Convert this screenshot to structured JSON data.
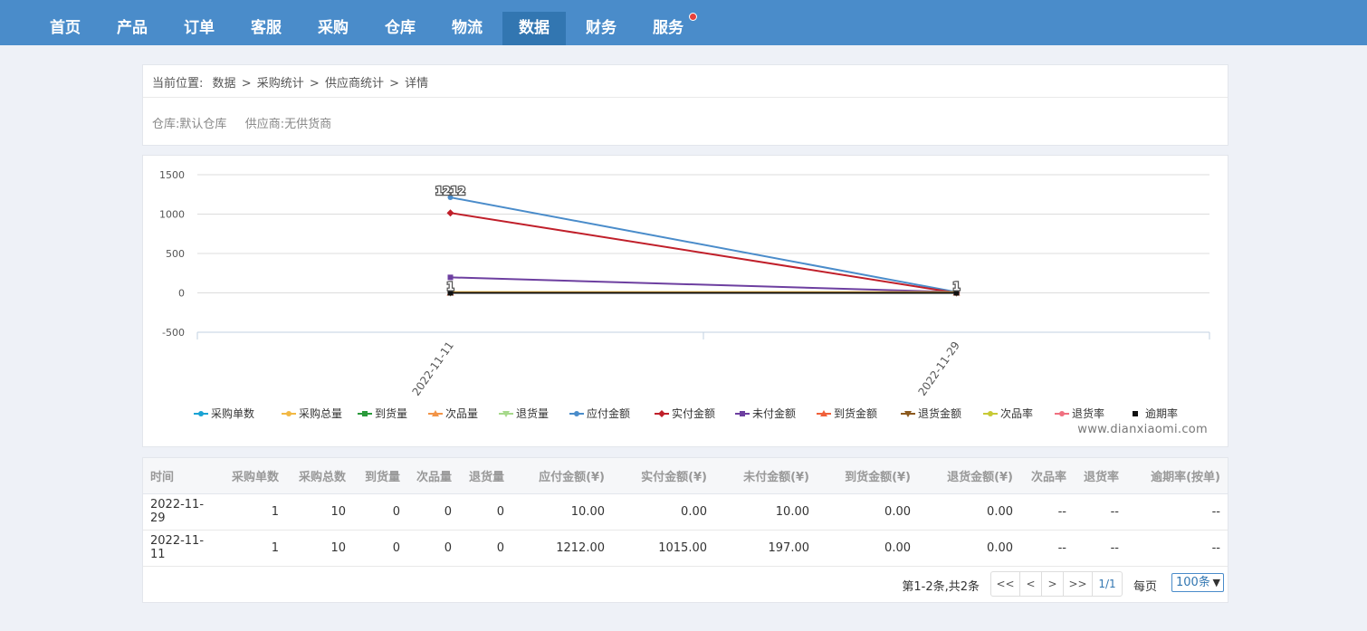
{
  "nav": {
    "items": [
      "首页",
      "产品",
      "订单",
      "客服",
      "采购",
      "仓库",
      "物流",
      "数据",
      "财务",
      "服务"
    ],
    "active": "数据",
    "badge_on": "服务"
  },
  "breadcrumb": {
    "prefix": "当前位置:",
    "items": [
      "数据",
      "采购统计",
      "供应商统计",
      "详情"
    ],
    "separator": ">"
  },
  "filters": {
    "warehouse_label": "仓库:",
    "warehouse_value": "默认仓库",
    "supplier_label": "供应商:",
    "supplier_value": "无供货商"
  },
  "chart_data": {
    "type": "line",
    "x": [
      "2022-11-11",
      "2022-11-29"
    ],
    "ylim": [
      -500,
      1500
    ],
    "yticks": [
      1500,
      1000,
      500,
      0,
      -500
    ],
    "grid": true,
    "legend_position": "bottom",
    "series": [
      {
        "name": "采购单数",
        "color": "#1aa3d4",
        "marker": "circle",
        "values": [
          1,
          1
        ]
      },
      {
        "name": "采购总量",
        "color": "#f2b844",
        "marker": "circle",
        "values": [
          10,
          10
        ]
      },
      {
        "name": "到货量",
        "color": "#2a9a3b",
        "marker": "square",
        "values": [
          0,
          0
        ]
      },
      {
        "name": "次品量",
        "color": "#f29447",
        "marker": "triangle",
        "values": [
          0,
          0
        ]
      },
      {
        "name": "退货量",
        "color": "#a6d98b",
        "marker": "triangle-down",
        "values": [
          0,
          0
        ]
      },
      {
        "name": "应付金额",
        "color": "#4a8cca",
        "marker": "circle",
        "values": [
          1212,
          10
        ],
        "data_labels": [
          "1212",
          ""
        ]
      },
      {
        "name": "实付金额",
        "color": "#c01f2a",
        "marker": "diamond",
        "values": [
          1015,
          0
        ]
      },
      {
        "name": "未付金额",
        "color": "#6d3fa0",
        "marker": "square",
        "values": [
          197,
          10
        ]
      },
      {
        "name": "到货金额",
        "color": "#f0603a",
        "marker": "triangle",
        "values": [
          0,
          0
        ]
      },
      {
        "name": "退货金额",
        "color": "#8c5a1e",
        "marker": "triangle-down",
        "values": [
          0,
          0
        ]
      },
      {
        "name": "次品率",
        "color": "#c7c935",
        "marker": "circle",
        "values": [
          0,
          0
        ]
      },
      {
        "name": "退货率",
        "color": "#f07080",
        "marker": "circle",
        "values": [
          0,
          0
        ]
      },
      {
        "name": "逾期率",
        "color": "#111111",
        "marker": "square",
        "values": [
          0,
          0
        ],
        "data_labels": [
          "1",
          "1"
        ]
      }
    ]
  },
  "watermark": "www.dianxiaomi.com",
  "table": {
    "headers": [
      "时间",
      "采购单数",
      "采购总数",
      "到货量",
      "次品量",
      "退货量",
      "应付金额(¥)",
      "实付金额(¥)",
      "未付金额(¥)",
      "到货金额(¥)",
      "退货金额(¥)",
      "次品率",
      "退货率",
      "逾期率(按单)"
    ],
    "rows": [
      [
        "2022-11-29",
        "1",
        "10",
        "0",
        "0",
        "0",
        "10.00",
        "0.00",
        "10.00",
        "0.00",
        "0.00",
        "--",
        "--",
        "--"
      ],
      [
        "2022-11-11",
        "1",
        "10",
        "0",
        "0",
        "0",
        "1212.00",
        "1015.00",
        "197.00",
        "0.00",
        "0.00",
        "--",
        "--",
        "--"
      ]
    ]
  },
  "pagination": {
    "summary": "第1-2条,共2条",
    "first": "<<",
    "prev": "<",
    "next": ">",
    "last": ">>",
    "page": "1/1",
    "per_page_label": "每页",
    "per_page_value": "100条"
  }
}
